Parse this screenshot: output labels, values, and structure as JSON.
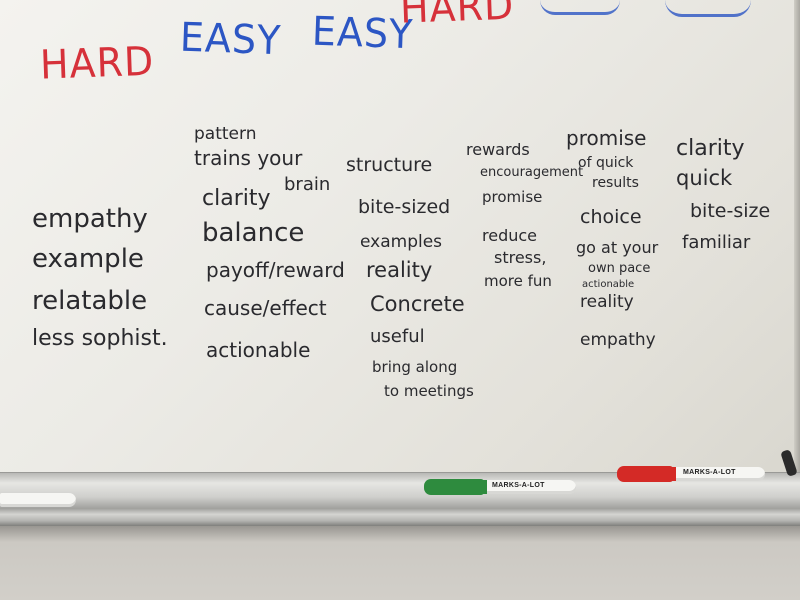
{
  "headers": [
    {
      "text": "HARD",
      "color": "#d6313a"
    },
    {
      "text": "EASY",
      "color": "#2c56c4"
    },
    {
      "text": "EASY",
      "color": "#2c56c4"
    },
    {
      "text": "HARD",
      "color": "#d6313a"
    }
  ],
  "columns": [
    {
      "items": [
        "empathy",
        "example",
        "relatable",
        "less sophist."
      ]
    },
    {
      "items": [
        "pattern",
        "trains your",
        "brain",
        "clarity",
        "balance",
        "payoff/reward",
        "cause/effect",
        "actionable"
      ]
    },
    {
      "items": [
        "structure",
        "bite-sized",
        "examples",
        "reality",
        "Concrete",
        "useful",
        "bring along",
        "to meetings"
      ]
    },
    {
      "items": [
        "rewards",
        "encouragement",
        "promise",
        "reduce",
        "stress,",
        "more fun"
      ]
    },
    {
      "items": [
        "promise",
        "of quick",
        "results",
        "choice",
        "go at your",
        "own pace",
        "actionable",
        "reality",
        "empathy"
      ]
    },
    {
      "items": [
        "clarity",
        "quick",
        "bite-size",
        "familiar"
      ]
    }
  ],
  "markers": [
    {
      "brand": "MARKS-A-LOT",
      "cap_color": "#2e8b3e"
    },
    {
      "brand": "MARKS-A-LOT",
      "cap_color": "#d42a26"
    }
  ],
  "colors": {
    "ink_dark": "#2a2a2e",
    "ink_red": "#d6313a",
    "ink_blue": "#2c56c4"
  }
}
